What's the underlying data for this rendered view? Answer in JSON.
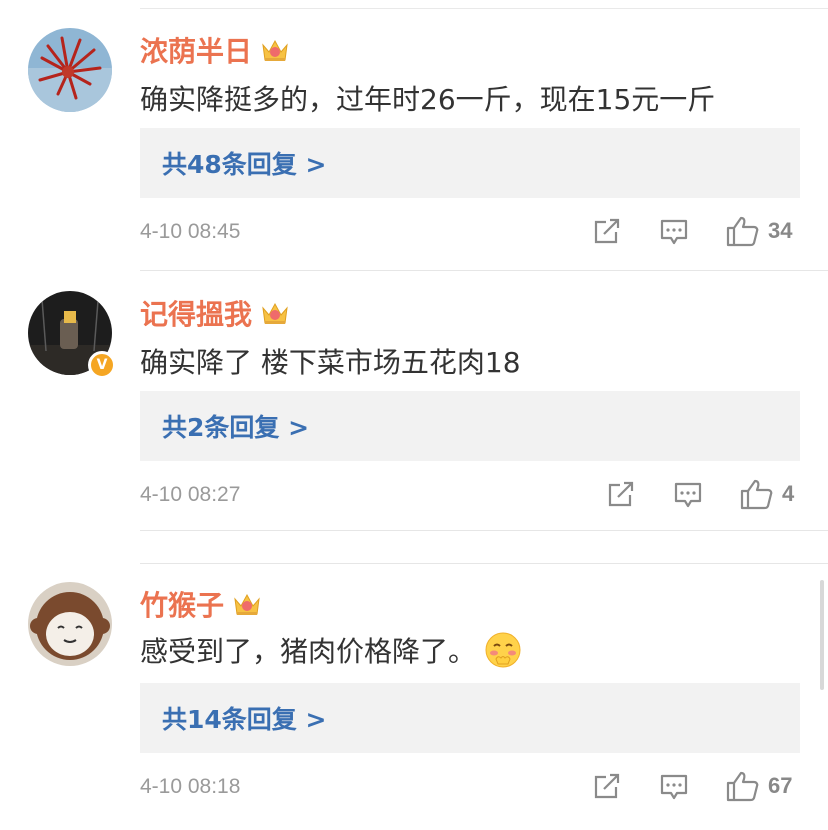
{
  "comments": [
    {
      "username": "浓荫半日",
      "text": "确实降挺多的，过年时26一斤，现在15元一斤",
      "replies": "共48条回复 >",
      "time": "4-10 08:45",
      "likes": "34",
      "verified": false
    },
    {
      "username": "记得搵我",
      "text": "确实降了 楼下菜市场五花肉18",
      "replies": "共2条回复 >",
      "time": "4-10 08:27",
      "likes": "4",
      "verified": true
    },
    {
      "username": "竹猴子",
      "text": "感受到了，猪肉价格降了。",
      "replies": "共14条回复 >",
      "time": "4-10 08:18",
      "likes": "67",
      "verified": false
    }
  ],
  "colors": {
    "username": "#eb7350",
    "text": "#333333",
    "reply_link": "#3a6fb2",
    "reply_bg": "#f2f2f2",
    "meta": "#9a9a9a",
    "badge": "#f5a623"
  },
  "icons": {
    "share": "share-icon",
    "comment": "comment-icon",
    "like": "thumbs-up-icon",
    "crown": "crown-badge-icon",
    "verified": "verified-badge-icon",
    "emoji": "shy-face-emoji"
  }
}
